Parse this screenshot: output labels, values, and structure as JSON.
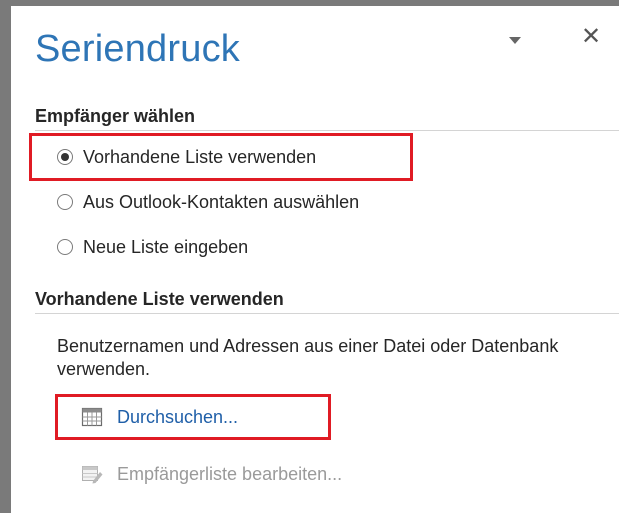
{
  "pane": {
    "title": "Seriendruck",
    "menu_icon": "dropdown-arrow-icon",
    "close_label": "✕"
  },
  "recipients": {
    "heading": "Empfänger wählen",
    "options": [
      {
        "label": "Vorhandene Liste verwenden",
        "checked": true
      },
      {
        "label": "Aus Outlook-Kontakten auswählen",
        "checked": false
      },
      {
        "label": "Neue Liste eingeben",
        "checked": false
      }
    ]
  },
  "existing_list": {
    "heading": "Vorhandene Liste verwenden",
    "description": "Benutzernamen und Adressen aus einer Datei oder Datenbank verwenden.",
    "browse_label": "Durchsuchen...",
    "browse_icon": "table-grid-icon",
    "edit_label": "Empfängerliste bearbeiten...",
    "edit_icon": "edit-list-icon",
    "edit_enabled": false
  },
  "colors": {
    "title": "#2e75b6",
    "link": "#1f5fa8",
    "disabled": "#9a9a9a",
    "highlight": "#e01b24"
  }
}
